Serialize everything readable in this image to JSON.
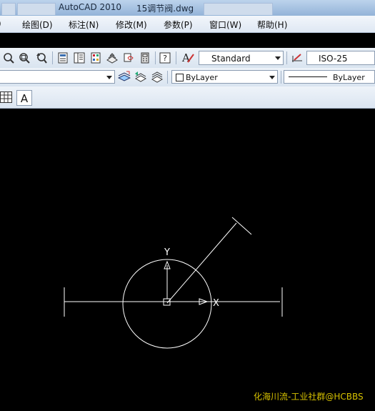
{
  "window": {
    "app_title": "AutoCAD 2010",
    "document_title": "15调节阀.dwg"
  },
  "menu": {
    "items": [
      {
        "label": "绘图(D)"
      },
      {
        "label": "标注(N)"
      },
      {
        "label": "修改(M)"
      },
      {
        "label": "参数(P)"
      },
      {
        "label": "窗口(W)"
      },
      {
        "label": "帮助(H)"
      }
    ]
  },
  "styles_toolbar": {
    "text_style": "Standard",
    "dim_style": "ISO-25"
  },
  "properties_toolbar": {
    "color": "ByLayer",
    "linetype": "ByLayer"
  },
  "canvas": {
    "background": "#000000",
    "geometry_color": "#ffffff",
    "ucs_x_label": "X",
    "ucs_y_label": "Y"
  },
  "watermark": "化海川流-工业社群@HCBBS"
}
